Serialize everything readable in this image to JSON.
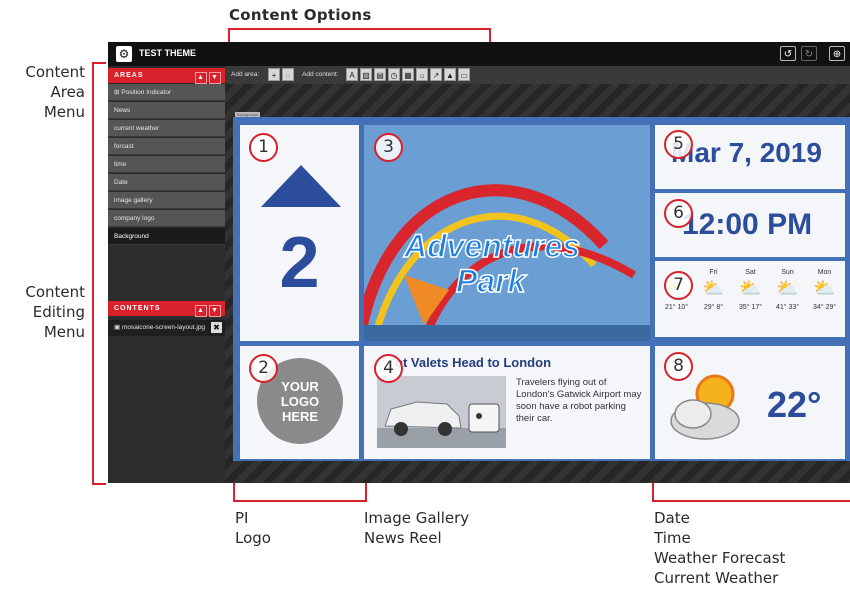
{
  "annotations": {
    "content_options": "Content Options",
    "content_area_menu": [
      "Content",
      "Area",
      "Menu"
    ],
    "content_editing_menu": [
      "Content",
      "Editing",
      "Menu"
    ],
    "bottom_left": [
      "PI",
      "Logo"
    ],
    "bottom_mid": [
      "Image Gallery",
      "News Reel"
    ],
    "bottom_right": [
      "Date",
      "Time",
      "Weather Forecast",
      "Current Weather"
    ]
  },
  "app": {
    "title": "TEST THEME",
    "icons": {
      "settings": "gear-icon",
      "undo": "undo-icon",
      "redo": "redo-icon",
      "zoom": "zoom-in-icon"
    }
  },
  "areas": {
    "header": "AREAS",
    "items": [
      {
        "label": "Position Indicator"
      },
      {
        "label": "News"
      },
      {
        "label": "current weather"
      },
      {
        "label": "forcast"
      },
      {
        "label": "time"
      },
      {
        "label": "Date"
      },
      {
        "label": "image gallery"
      },
      {
        "label": "company logo"
      },
      {
        "label": "Background",
        "selected": true
      }
    ]
  },
  "contents": {
    "header": "CONTENTS",
    "items": [
      {
        "label": "mosaicone-screen-layout.jpg"
      }
    ]
  },
  "toolbar": {
    "add_area_label": "Add area:",
    "add_content_label": "Add content:",
    "area_tools": [
      "add-icon",
      "comment-icon"
    ],
    "content_tools": [
      "text-icon",
      "image-icon",
      "video-icon",
      "clock-icon",
      "ticker-icon",
      "weather-icon",
      "chart-icon",
      "gallery-icon",
      "document-icon"
    ]
  },
  "screen": {
    "zone_labels": {
      "background": "Background"
    },
    "pi": {
      "number": "2",
      "marker": "1"
    },
    "logo": {
      "lines": [
        "YOUR",
        "LOGO",
        "HERE"
      ],
      "marker": "2"
    },
    "image": {
      "line1": "Adventures",
      "line2": "Park",
      "marker": "3"
    },
    "news": {
      "headline": "ot Valets Head to London",
      "body": "Travelers flying out of London's Gatwick Airport may soon have a robot parking their car.",
      "marker": "4"
    },
    "date": {
      "text": "Mar 7, 2019",
      "marker": "5"
    },
    "time": {
      "text": "12:00 PM",
      "marker": "6"
    },
    "forecast": {
      "marker": "7",
      "days": [
        {
          "day": "",
          "temps": "21° 10°"
        },
        {
          "day": "Fri",
          "temps": "29° 8°"
        },
        {
          "day": "Sat",
          "temps": "35° 17°"
        },
        {
          "day": "Sun",
          "temps": "41° 33°"
        },
        {
          "day": "Mon",
          "temps": "34° 29°"
        }
      ]
    },
    "weather": {
      "temp": "22°",
      "marker": "8"
    }
  },
  "colors": {
    "accent": "#d8212a",
    "screen_blue": "#4470b8",
    "text_blue": "#2b4d9c"
  }
}
